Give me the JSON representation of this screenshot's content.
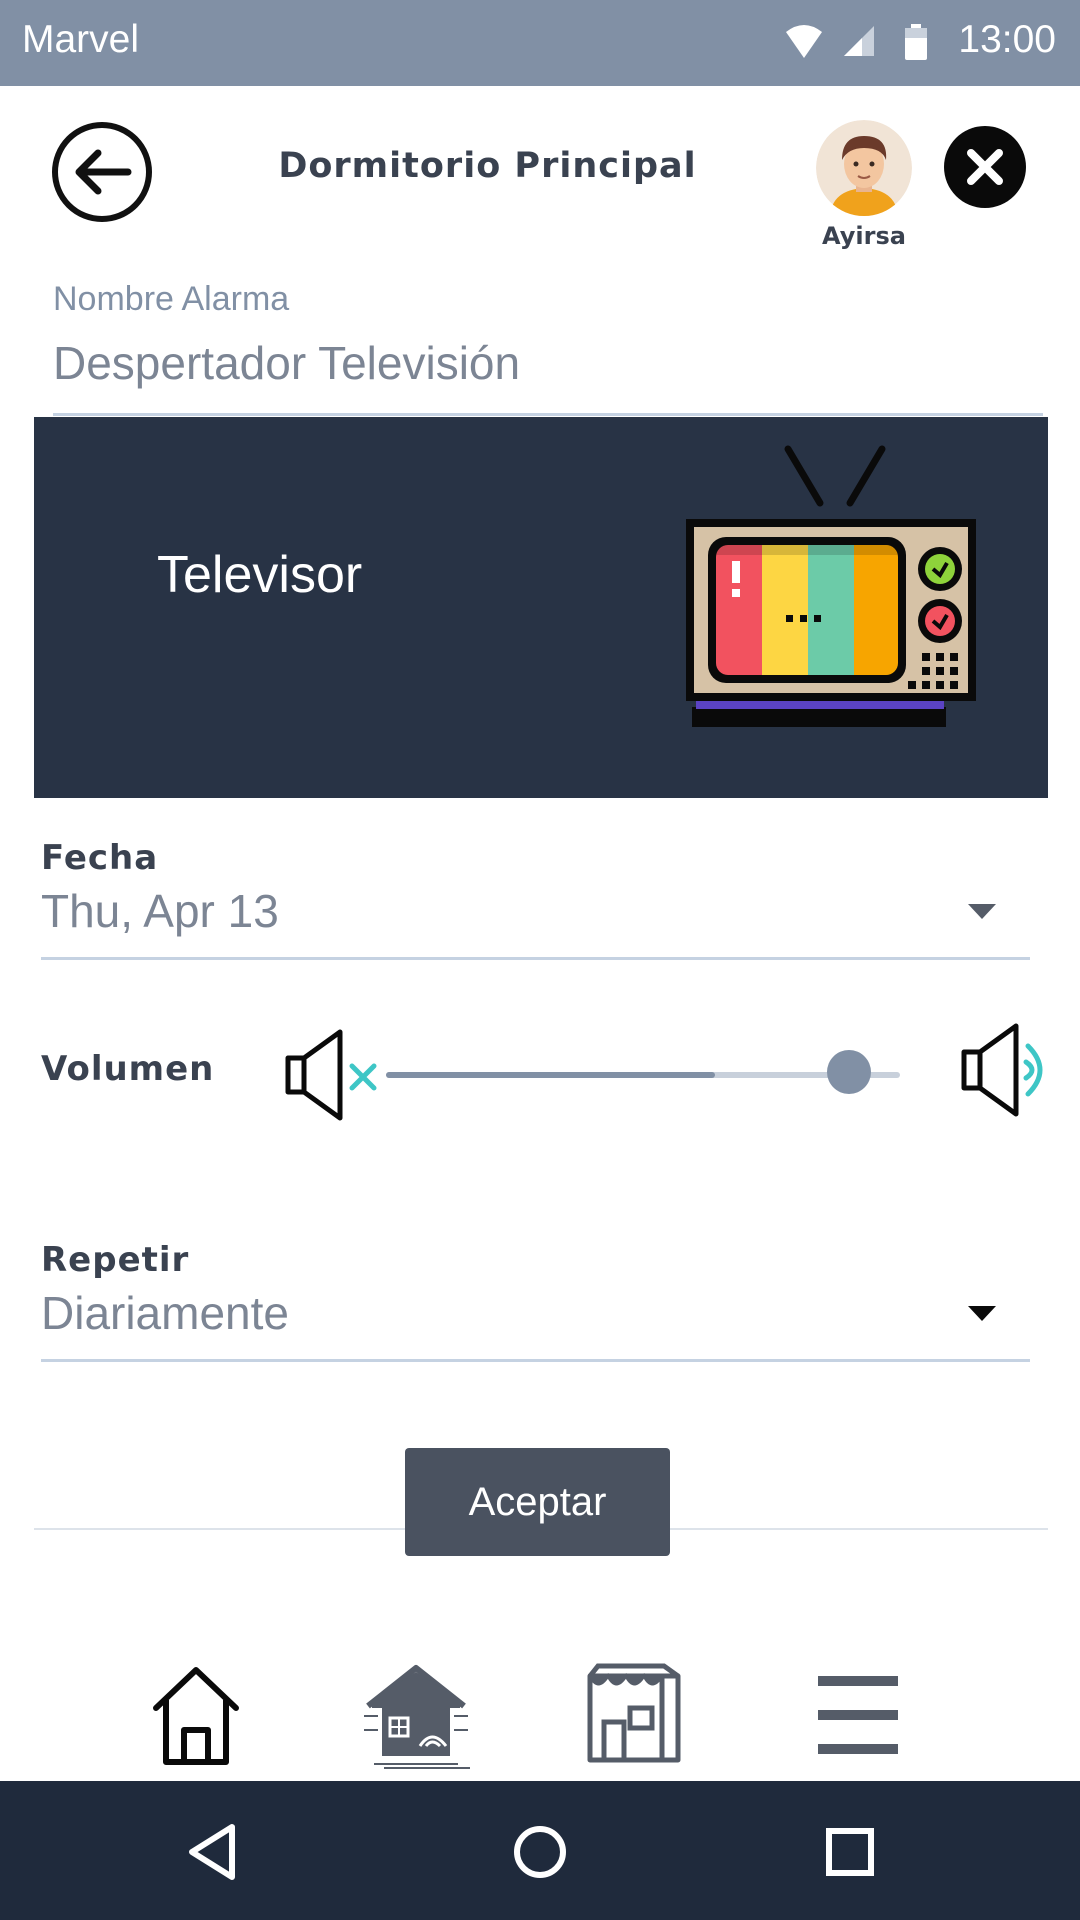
{
  "status_bar": {
    "carrier": "Marvel",
    "time": "13:00",
    "icons": [
      "wifi-icon",
      "signal-icon",
      "battery-icon"
    ]
  },
  "header": {
    "title": "Dormitorio Principal",
    "user_name": "Ayirsa",
    "back_icon": "arrow-left-circle-icon",
    "close_icon": "close-circle-icon"
  },
  "alarm_name": {
    "label": "Nombre Alarma",
    "value": "Despertador Televisión"
  },
  "device": {
    "name": "Televisor",
    "icon": "television-icon"
  },
  "date_field": {
    "label": "Fecha",
    "value": "Thu, Apr 13"
  },
  "volume": {
    "label": "Volumen",
    "level": 0.9,
    "buffer": 0.64
  },
  "repeat_field": {
    "label": "Repetir",
    "value": "Diariamente"
  },
  "accept_label": "Aceptar",
  "tabs": [
    "home-icon",
    "smart-home-icon",
    "store-icon",
    "menu-icon"
  ],
  "nav": [
    "back-icon",
    "home-circle-icon",
    "recents-icon"
  ],
  "colors": {
    "accent": "#8190a5",
    "card": "#283345",
    "button": "#4a5260",
    "navbar": "#1f2a3c",
    "teal": "#3ec6c6"
  }
}
